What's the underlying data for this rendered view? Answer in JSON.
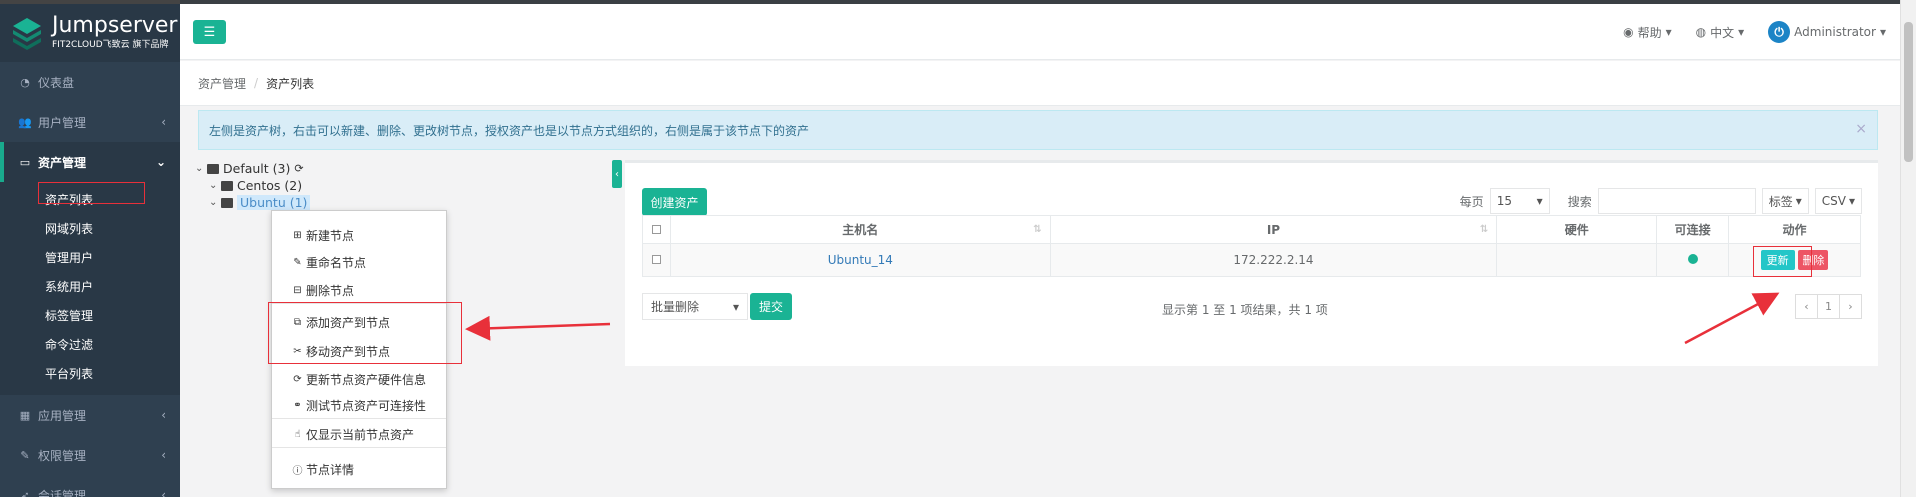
{
  "brand": {
    "name": "Jumpserver",
    "tagline": "FIT2CLOUD飞致云 旗下品牌"
  },
  "sidebar": {
    "items": [
      {
        "label": "仪表盘",
        "icon": "dashboard-icon"
      },
      {
        "label": "用户管理",
        "icon": "users-icon"
      },
      {
        "label": "资产管理",
        "icon": "inbox-icon"
      },
      {
        "label": "应用管理",
        "icon": "grid-icon"
      },
      {
        "label": "权限管理",
        "icon": "edit-icon"
      },
      {
        "label": "会话管理",
        "icon": "rocket-icon"
      }
    ],
    "asset_sub": [
      "资产列表",
      "网域列表",
      "管理用户",
      "系统用户",
      "标签管理",
      "命令过滤",
      "平台列表"
    ]
  },
  "topbar": {
    "help": "帮助",
    "language": "中文",
    "user": "Administrator"
  },
  "breadcrumb": {
    "root": "资产管理",
    "current": "资产列表"
  },
  "alert": {
    "text": "左侧是资产树，右击可以新建、删除、更改树节点，授权资产也是以节点方式组织的，右侧是属于该节点下的资产"
  },
  "tree": [
    {
      "label": "Default (3)"
    },
    {
      "label": "Centos (2)"
    },
    {
      "label": "Ubuntu (1)"
    }
  ],
  "context_menu": {
    "new_node": "新建节点",
    "rename_node": "重命名节点",
    "delete_node": "删除节点",
    "add_asset": "添加资产到节点",
    "move_asset": "移动资产到节点",
    "update_hw": "更新节点资产硬件信息",
    "test_conn": "测试节点资产可连接性",
    "only_current": "仅显示当前节点资产",
    "details": "节点详情"
  },
  "toolbar": {
    "create": "创建资产",
    "per_page_label": "每页",
    "per_page_value": "15",
    "search_label": "搜索",
    "labels": "标签",
    "export": "CSV"
  },
  "table": {
    "headers": {
      "hostname": "主机名",
      "ip": "IP",
      "hardware": "硬件",
      "connectivity": "可连接",
      "actions": "动作"
    },
    "rows": [
      {
        "hostname": "Ubuntu_14",
        "ip": "172.222.2.14",
        "hardware": "",
        "update": "更新",
        "delete": "删除"
      }
    ]
  },
  "footer": {
    "bulk_action": "批量删除",
    "submit": "提交",
    "info": "显示第 1 至 1 项结果，共 1 项",
    "page": "1",
    "prev": "‹",
    "next": "›"
  },
  "colors": {
    "sidebar": "#2f4050",
    "accent": "#1ab394",
    "alert_bg": "#d9edf7",
    "danger": "#ed5565",
    "annotation": "#e8303a"
  }
}
